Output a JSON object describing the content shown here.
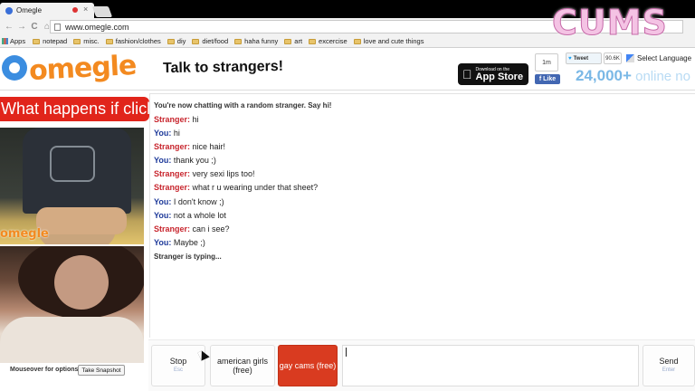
{
  "browser": {
    "tab_title": "Omegle",
    "tab_close": "×",
    "address": "www.omegle.com",
    "nav": {
      "back": "←",
      "forward": "→",
      "reload": "C",
      "home": "⌂"
    },
    "bookmarks": [
      "notepad",
      "misc.",
      "fashion/clothes",
      "diy",
      "diet/food",
      "haha funny",
      "art",
      "excercise",
      "love and cute things"
    ],
    "apps_label": "Apps"
  },
  "overlay_logo": "CUMS",
  "header": {
    "logo_text": "omegle",
    "tagline": "Talk to strangers!",
    "appstore_small": "Download on the",
    "appstore_large": "App Store",
    "fb_count": "1m",
    "fb_like": "Like",
    "tweet_label": "Tweet",
    "tweet_count": "90.6K",
    "language": "Select Language",
    "online_count": "24,000+",
    "online_text": " online no"
  },
  "left": {
    "promo": "What happens if click?",
    "watermark": "omegle",
    "mouseover": "Mouseover for options",
    "snapshot": "Take Snapshot"
  },
  "chat": {
    "intro": "You're now chatting with a random stranger. Say hi!",
    "messages": [
      {
        "who": "Stranger:",
        "text": " hi"
      },
      {
        "who": "You:",
        "text": " hi"
      },
      {
        "who": "Stranger:",
        "text": " nice hair!"
      },
      {
        "who": "You:",
        "text": " thank you ;)"
      },
      {
        "who": "Stranger:",
        "text": " very sexi lips too!"
      },
      {
        "who": "Stranger:",
        "text": " what r u wearing under that sheet?"
      },
      {
        "who": "You:",
        "text": " I don't know ;)"
      },
      {
        "who": "You:",
        "text": " not a whole lot"
      },
      {
        "who": "Stranger:",
        "text": " can i see?"
      },
      {
        "who": "You:",
        "text": " Maybe ;)"
      }
    ],
    "typing": "Stranger is typing..."
  },
  "controls": {
    "stop": "Stop",
    "stop_sub": "Esc",
    "american_girls": "american girls (free)",
    "gay_cams": "gay cams (free)",
    "input_value": "",
    "send": "Send",
    "send_sub": "Enter"
  }
}
